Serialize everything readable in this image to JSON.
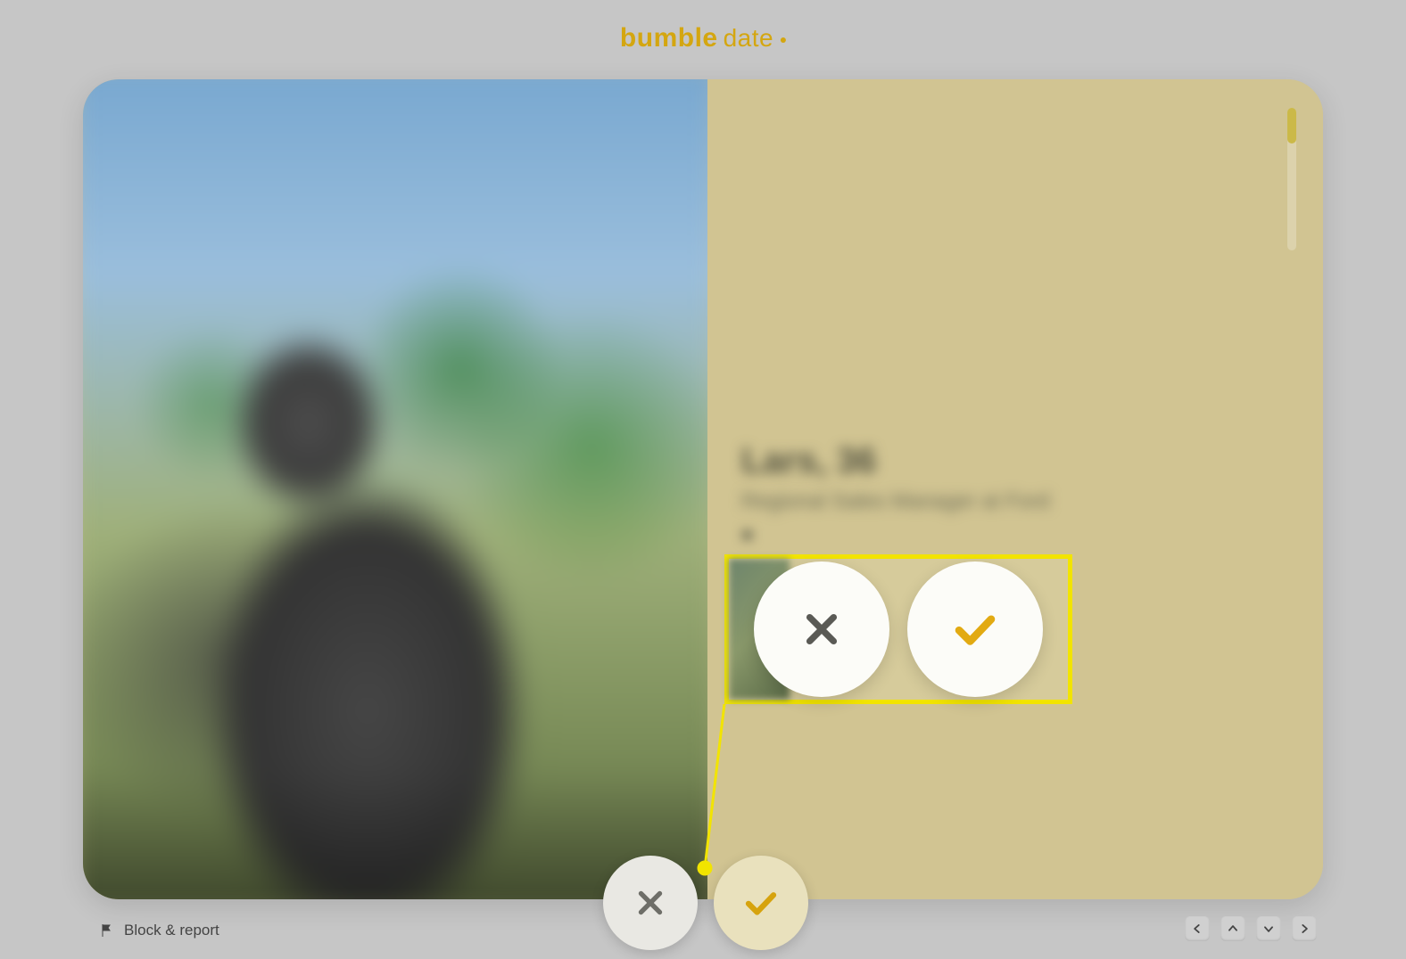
{
  "brand": {
    "name": "bumble",
    "mode": "date"
  },
  "profile": {
    "name": "Lars",
    "age": "36",
    "occupation": "Regional Sales Manager at Ford"
  },
  "actions": {
    "pass_label": "Pass",
    "like_label": "Like"
  },
  "footer": {
    "block_report": "Block & report"
  },
  "callout": {
    "pass_label": "Pass",
    "like_label": "Like"
  }
}
